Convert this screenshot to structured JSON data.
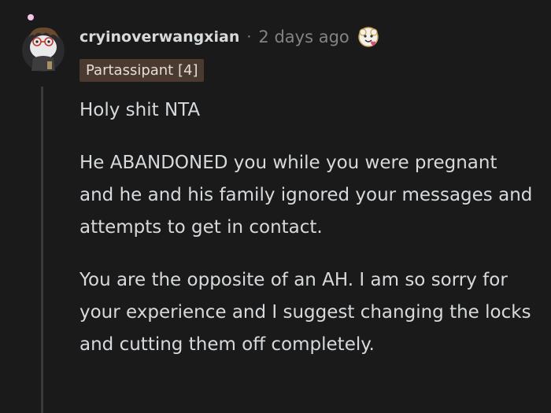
{
  "comment": {
    "author": "cryinoverwangxian",
    "separator": "·",
    "timestamp": "2 days ago",
    "flair": "Partassipant [4]",
    "paragraphs": [
      "Holy shit NTA",
      "He ABANDONED you while you were pregnant and he and his family ignored your messages and attempts to get in contact.",
      "You are the opposite of an AH. I am so sorry for your experience and I suggest changing the locks and cutting them off completely."
    ]
  },
  "icons": {
    "avatar": "snoo-avatar-with-glasses",
    "award": "wholesome-award-icon"
  },
  "colors": {
    "background": "#1a1a1b",
    "text": "#d7dadc",
    "meta": "#818384",
    "flair_bg": "#4a3a2f"
  }
}
